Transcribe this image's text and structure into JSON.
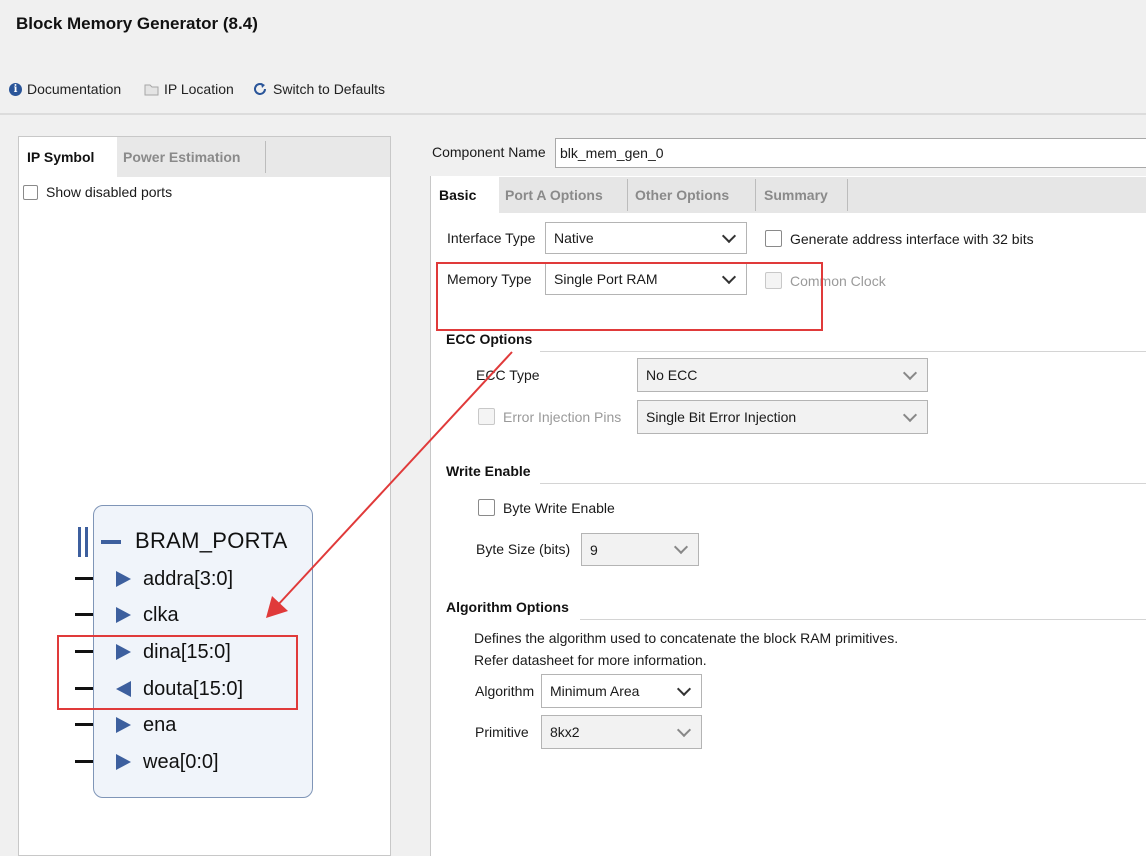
{
  "window": {
    "title": "Block Memory Generator (8.4)"
  },
  "toolbar": {
    "documentation": "Documentation",
    "ip_location": "IP Location",
    "switch_defaults": "Switch to Defaults"
  },
  "left_panel": {
    "tabs": [
      "IP Symbol",
      "Power Estimation"
    ],
    "active_tab": "IP Symbol",
    "show_disabled_ports": "Show disabled ports",
    "symbol": {
      "interface": "BRAM_PORTA",
      "ports": [
        {
          "name": "addra[3:0]",
          "dir": "in"
        },
        {
          "name": "clka",
          "dir": "in"
        },
        {
          "name": "dina[15:0]",
          "dir": "in"
        },
        {
          "name": "douta[15:0]",
          "dir": "out"
        },
        {
          "name": "ena",
          "dir": "in"
        },
        {
          "name": "wea[0:0]",
          "dir": "in"
        }
      ]
    }
  },
  "component": {
    "label": "Component Name",
    "value": "blk_mem_gen_0"
  },
  "right_tabs": [
    "Basic",
    "Port A Options",
    "Other Options",
    "Summary"
  ],
  "right_active_tab": "Basic",
  "basic": {
    "interface_type_label": "Interface Type",
    "interface_type_value": "Native",
    "gen_addr_32": "Generate address interface with 32 bits",
    "memory_type_label": "Memory Type",
    "memory_type_value": "Single Port RAM",
    "common_clock": "Common Clock",
    "ecc": {
      "title": "ECC Options",
      "type_label": "ECC Type",
      "type_value": "No ECC",
      "error_injection_label": "Error Injection Pins",
      "error_injection_value": "Single Bit Error Injection"
    },
    "write_enable": {
      "title": "Write Enable",
      "byte_write_enable": "Byte Write Enable",
      "byte_size_label": "Byte Size (bits)",
      "byte_size_value": "9"
    },
    "algorithm": {
      "title": "Algorithm Options",
      "desc1": "Defines the algorithm used to concatenate the block RAM primitives.",
      "desc2": "Refer datasheet for more information.",
      "algorithm_label": "Algorithm",
      "algorithm_value": "Minimum Area",
      "primitive_label": "Primitive",
      "primitive_value": "8kx2"
    }
  },
  "colors": {
    "annotation": "#e03a3a",
    "symbol_blue": "#3d5f9e"
  }
}
